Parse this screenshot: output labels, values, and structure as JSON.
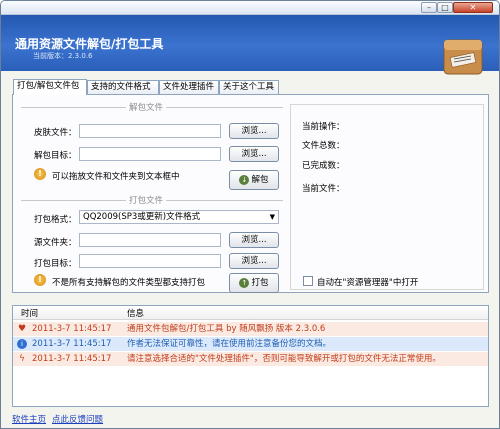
{
  "banner": {
    "title": "通用资源文件解包/打包工具",
    "version": "当前版本：2.3.0.6"
  },
  "window_controls": {
    "min": "–",
    "max": "□",
    "close": "✕"
  },
  "tabs": [
    {
      "label": "打包/解包文件包"
    },
    {
      "label": "支持的文件格式"
    },
    {
      "label": "文件处理插件"
    },
    {
      "label": "关于这个工具"
    }
  ],
  "unpack": {
    "group_title": "解包文件",
    "skin_label": "皮肤文件：",
    "skin_value": "",
    "target_label": "解包目标：",
    "target_value": "",
    "browse": "浏览...",
    "hint": "可以拖放文件和文件夹到文本框中",
    "button": "解包"
  },
  "pack": {
    "group_title": "打包文件",
    "format_label": "打包格式：",
    "format_value": "QQ2009(SP3或更新)文件格式",
    "source_label": "源文件夹：",
    "source_value": "",
    "target_label": "打包目标：",
    "target_value": "",
    "browse": "浏览...",
    "hint": "不是所有支持解包的文件类型都支持打包",
    "button": "打包"
  },
  "status": {
    "current_op": "当前操作：",
    "total": "文件总数：",
    "done": "已完成数：",
    "current_file": "当前文件：",
    "auto_open": "自动在\"资源管理器\"中打开",
    "auto_open_checked": false
  },
  "log": {
    "col_time": "时间",
    "col_info": "信息",
    "rows": [
      {
        "icon": "heart-icon",
        "time": "2011-3-7 11:45:17",
        "info": "通用文件包解包/打包工具 by 随风飘扬 版本 2.3.0.6"
      },
      {
        "icon": "info-icon",
        "time": "2011-3-7 11:45:17",
        "info": "作者无法保证可靠性，请在使用前注意备份您的文档。"
      },
      {
        "icon": "lightning-icon",
        "time": "2011-3-7 11:45:17",
        "info": "请注意选择合适的\"文件处理插件\"，否则可能导致解开或打包的文件无法正常使用。"
      }
    ]
  },
  "footer": {
    "home": "软件主页",
    "feedback": "点此反馈问题"
  }
}
